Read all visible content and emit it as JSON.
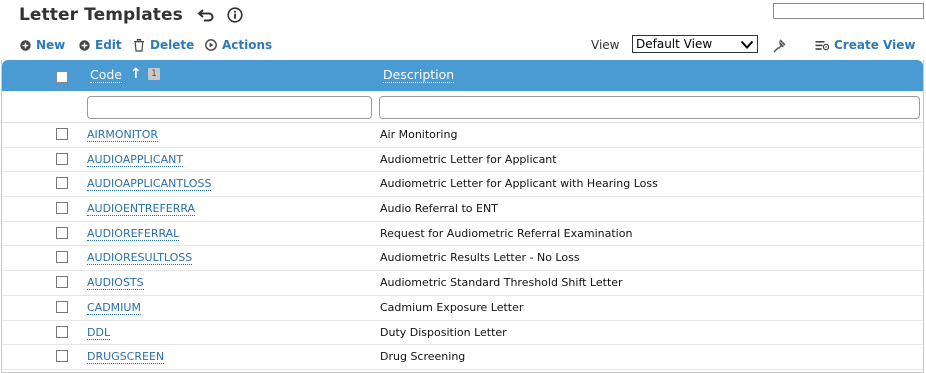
{
  "header": {
    "title": "Letter Templates",
    "search_value": ""
  },
  "toolbar": {
    "new_label": "New",
    "edit_label": "Edit",
    "delete_label": "Delete",
    "actions_label": "Actions",
    "view_label": "View",
    "view_selected": "Default View",
    "create_view_label": "Create View"
  },
  "grid": {
    "columns": {
      "code": "Code",
      "sort_order": "1",
      "description": "Description"
    },
    "filters": {
      "code": "",
      "description": ""
    },
    "rows": [
      {
        "code": "AIRMONITOR",
        "description": "Air Monitoring"
      },
      {
        "code": "AUDIOAPPLICANT",
        "description": "Audiometric Letter for Applicant"
      },
      {
        "code": "AUDIOAPPLICANTLOSS",
        "description": "Audiometric Letter for Applicant with Hearing Loss"
      },
      {
        "code": "AUDIOENTREFERRA",
        "description": "Audio Referral to ENT"
      },
      {
        "code": "AUDIOREFERRAL",
        "description": "Request for Audiometric Referral Examination"
      },
      {
        "code": "AUDIORESULTLOSS",
        "description": "Audiometric Results Letter - No Loss"
      },
      {
        "code": "AUDIOSTS",
        "description": "Audiometric Standard Threshold Shift Letter"
      },
      {
        "code": "CADMIUM",
        "description": "Cadmium Exposure Letter"
      },
      {
        "code": "DDL",
        "description": "Duty Disposition Letter"
      },
      {
        "code": "DRUGSCREEN",
        "description": "Drug Screening"
      }
    ]
  },
  "colors": {
    "accent": "#2e7ab8",
    "header_bg": "#4a9bd4"
  },
  "icons": {
    "back": "return-arrow-icon",
    "info": "info-icon",
    "new": "plus-circle-icon",
    "edit": "plus-circle-icon",
    "delete": "trash-icon",
    "actions": "play-circle-icon",
    "pin": "pin-icon",
    "create_view": "list-settings-icon"
  }
}
